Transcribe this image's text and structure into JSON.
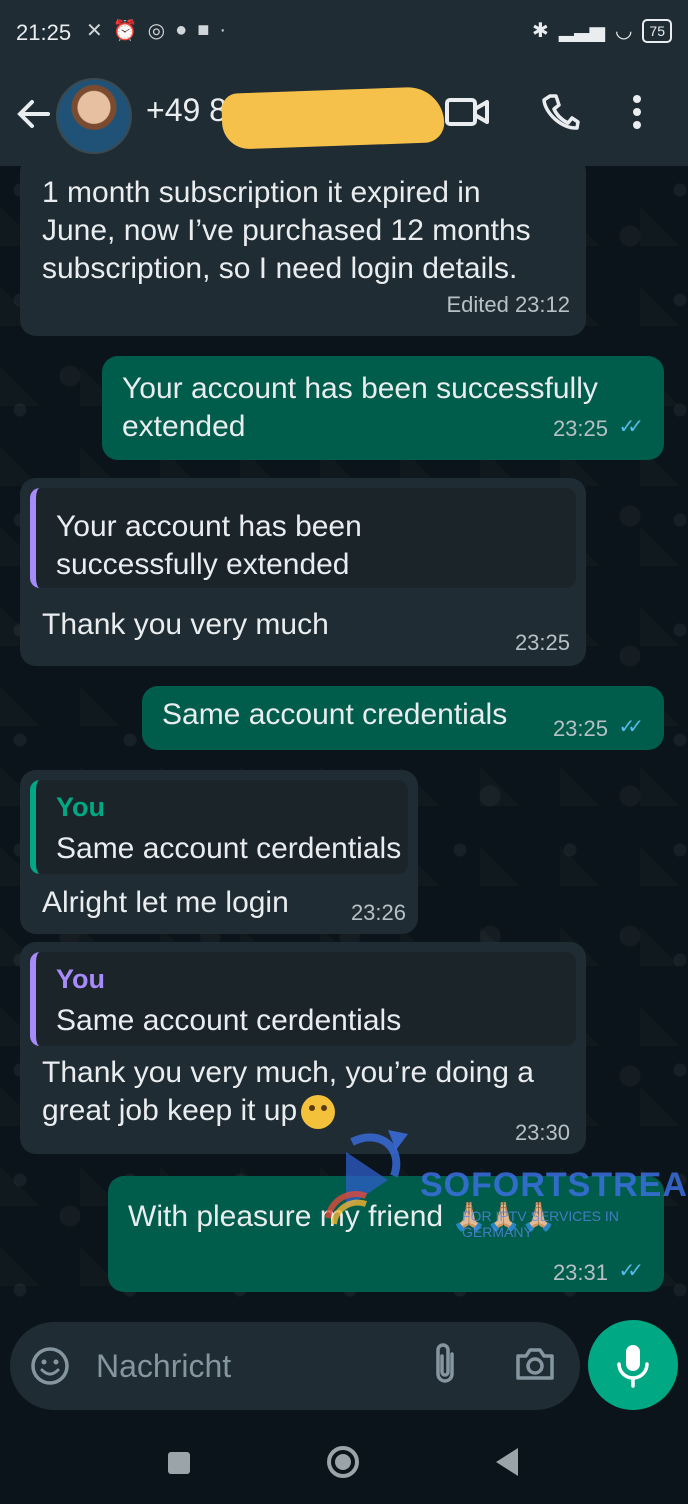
{
  "status_bar": {
    "time": "21:25",
    "left_icons": [
      "mute-vibrate-icon",
      "alarm-icon",
      "whatsapp-icon",
      "message-icon",
      "app-icon"
    ],
    "right_icons": [
      "bluetooth-icon",
      "signal-icon",
      "wifi-icon",
      "battery-icon"
    ],
    "battery_level": "75"
  },
  "header": {
    "contact_visible": "+49 8",
    "contact_redacted": true,
    "actions": [
      "video-call-icon",
      "phone-call-icon",
      "more-options-icon"
    ]
  },
  "messages": [
    {
      "direction": "incoming",
      "text_lines": [
        "1 month subscription it expired in",
        "June, now I’ve purchased 12 months",
        "subscription, so I need login details."
      ],
      "time": "Edited 23:12"
    },
    {
      "direction": "outgoing",
      "text_lines": [
        "Your account has been successfully",
        "extended"
      ],
      "time": "23:25",
      "status": "read"
    },
    {
      "direction": "incoming",
      "quote": {
        "author": "",
        "text_lines": [
          "Your account has been",
          "successfully extended"
        ]
      },
      "text_lines": [
        "Thank you very much"
      ],
      "time": "23:25"
    },
    {
      "direction": "outgoing",
      "text_lines": [
        "Same account credentials"
      ],
      "time": "23:25",
      "status": "read"
    },
    {
      "direction": "incoming",
      "quote": {
        "author": "You",
        "text_lines": [
          "Same account cerdentials"
        ]
      },
      "text_lines": [
        "Alright let me login"
      ],
      "time": "23:26"
    },
    {
      "direction": "incoming",
      "quote": {
        "author": "You",
        "text_lines": [
          "Same account cerdentials"
        ]
      },
      "text_lines": [
        "Thank you very much, you’re doing a",
        "great job keep it up"
      ],
      "emoji": "smiling-face-emoji",
      "time": "23:30"
    },
    {
      "direction": "outgoing",
      "text_lines": [
        "With pleasure my friend"
      ],
      "emojis": [
        "🙏🏼",
        "🙏🏼",
        "🙏🏼"
      ],
      "time": "23:31",
      "status": "read"
    }
  ],
  "watermark": {
    "title": "SOFORTSTREAM",
    "subtitle": "FOR IPTV SERVICES IN GERMANY"
  },
  "composer": {
    "placeholder": "Nachricht",
    "icons": [
      "emoji-icon",
      "attachment-icon",
      "camera-icon",
      "microphone-icon"
    ]
  },
  "navigation": {
    "buttons": [
      "recent-apps-button",
      "home-button",
      "back-button"
    ]
  },
  "colors": {
    "background": "#0b141a",
    "incoming_bubble": "#202c33",
    "outgoing_bubble": "#005c4b",
    "accent": "#00a884",
    "read_ticks": "#53bdeb",
    "quote_purple": "#a78bfa"
  }
}
